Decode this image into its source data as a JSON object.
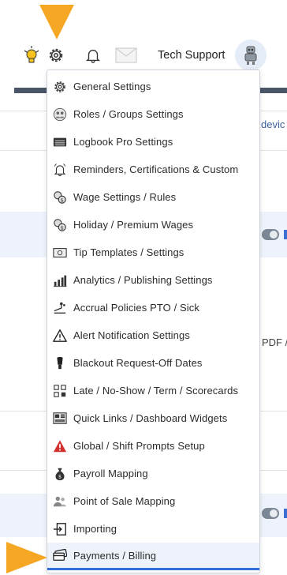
{
  "header": {
    "title": "Tech Support",
    "icons": [
      "lightbulb-icon",
      "gear-icon",
      "bell-icon",
      "mail-icon",
      "robot-avatar-icon"
    ]
  },
  "background": {
    "text_right_top": "devic",
    "text_right_mid": "PDF /",
    "text_right_edge_1": "I",
    "text_right_edge_2": "I"
  },
  "menu": {
    "items": [
      {
        "label": "General Settings",
        "icon": "gear-icon"
      },
      {
        "label": "Roles / Groups Settings",
        "icon": "roles-icon"
      },
      {
        "label": "Logbook Pro Settings",
        "icon": "logbook-icon"
      },
      {
        "label": "Reminders, Certifications & Custom",
        "icon": "reminder-bell-icon"
      },
      {
        "label": "Wage Settings / Rules",
        "icon": "wage-icon"
      },
      {
        "label": "Holiday / Premium Wages",
        "icon": "holiday-wage-icon"
      },
      {
        "label": "Tip Templates / Settings",
        "icon": "tip-icon"
      },
      {
        "label": "Analytics / Publishing Settings",
        "icon": "analytics-icon"
      },
      {
        "label": "Accrual Policies PTO / Sick",
        "icon": "accrual-icon"
      },
      {
        "label": "Alert Notification Settings",
        "icon": "alert-triangle-icon"
      },
      {
        "label": "Blackout Request-Off Dates",
        "icon": "blackout-icon"
      },
      {
        "label": "Late / No-Show / Term / Scorecards",
        "icon": "scorecard-icon"
      },
      {
        "label": "Quick Links / Dashboard Widgets",
        "icon": "dashboard-icon"
      },
      {
        "label": "Global / Shift Prompts Setup",
        "icon": "warning-red-icon"
      },
      {
        "label": "Payroll Mapping",
        "icon": "money-bag-icon"
      },
      {
        "label": "Point of Sale Mapping",
        "icon": "pos-users-icon"
      },
      {
        "label": "Importing",
        "icon": "import-icon"
      },
      {
        "label": "Payments / Billing",
        "icon": "payment-card-icon"
      }
    ],
    "active_index": 17
  },
  "colors": {
    "accent": "#2f6fd8",
    "arrow": "#f5a623",
    "alert_red": "#d32f2f",
    "bulb": "#f7c31e"
  }
}
